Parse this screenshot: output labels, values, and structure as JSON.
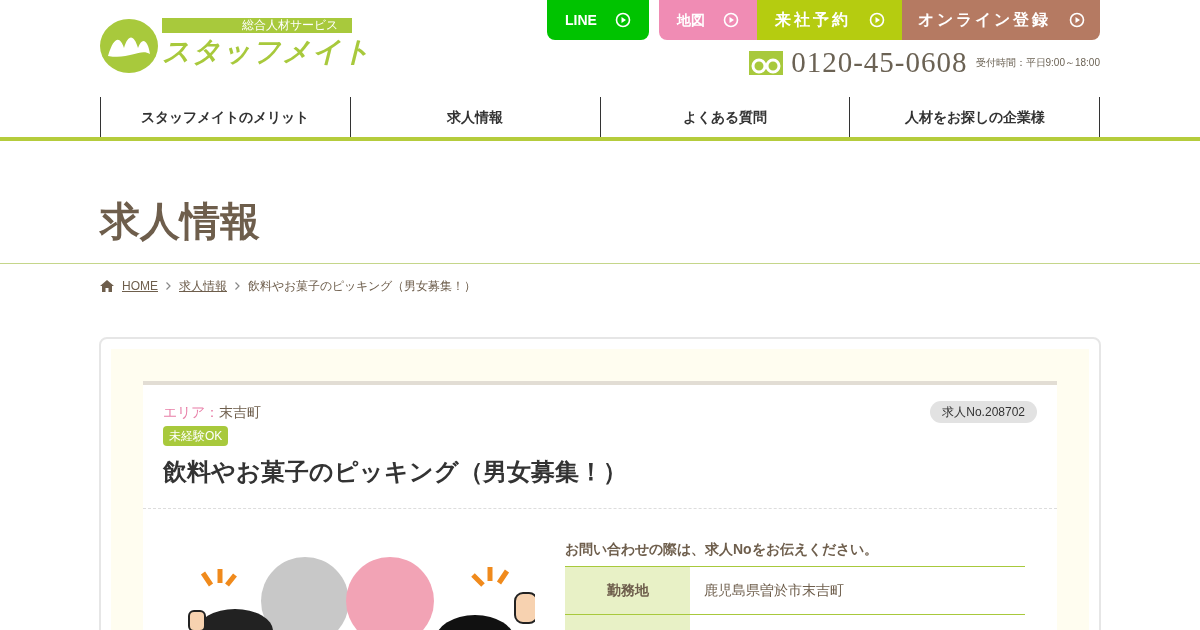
{
  "logo": {
    "tagline": "総合人材サービス",
    "name": "スタッフメイト"
  },
  "header_buttons": [
    {
      "kind": "line",
      "label": "LINE"
    },
    {
      "kind": "map",
      "label": "地図"
    },
    {
      "kind": "visit",
      "label": "来社予約"
    },
    {
      "kind": "online",
      "label": "オンライン登録"
    }
  ],
  "phone": {
    "number": "0120-45-0608",
    "hours": "受付時間：平日9:00～18:00"
  },
  "nav": [
    {
      "label": "スタッフメイトのメリット"
    },
    {
      "label": "求人情報"
    },
    {
      "label": "よくある質問"
    },
    {
      "label": "人材をお探しの企業様"
    }
  ],
  "page_title": "求人情報",
  "breadcrumb": [
    {
      "label": "HOME",
      "link": true
    },
    {
      "label": "求人情報",
      "link": true
    },
    {
      "label": "飲料やお菓子のピッキング（男女募集！）",
      "link": false
    }
  ],
  "job": {
    "area_label": "エリア：",
    "area": "末吉町",
    "job_no": "求人No.208702",
    "tags": [
      "未経験OK"
    ],
    "title": "飲料やお菓子のピッキング（男女募集！）",
    "contact_note": "お問い合わせの際は、求人Noをお伝えください。",
    "details": [
      {
        "label": "勤務地",
        "value": "鹿児島県曽於市末吉町"
      }
    ]
  }
}
